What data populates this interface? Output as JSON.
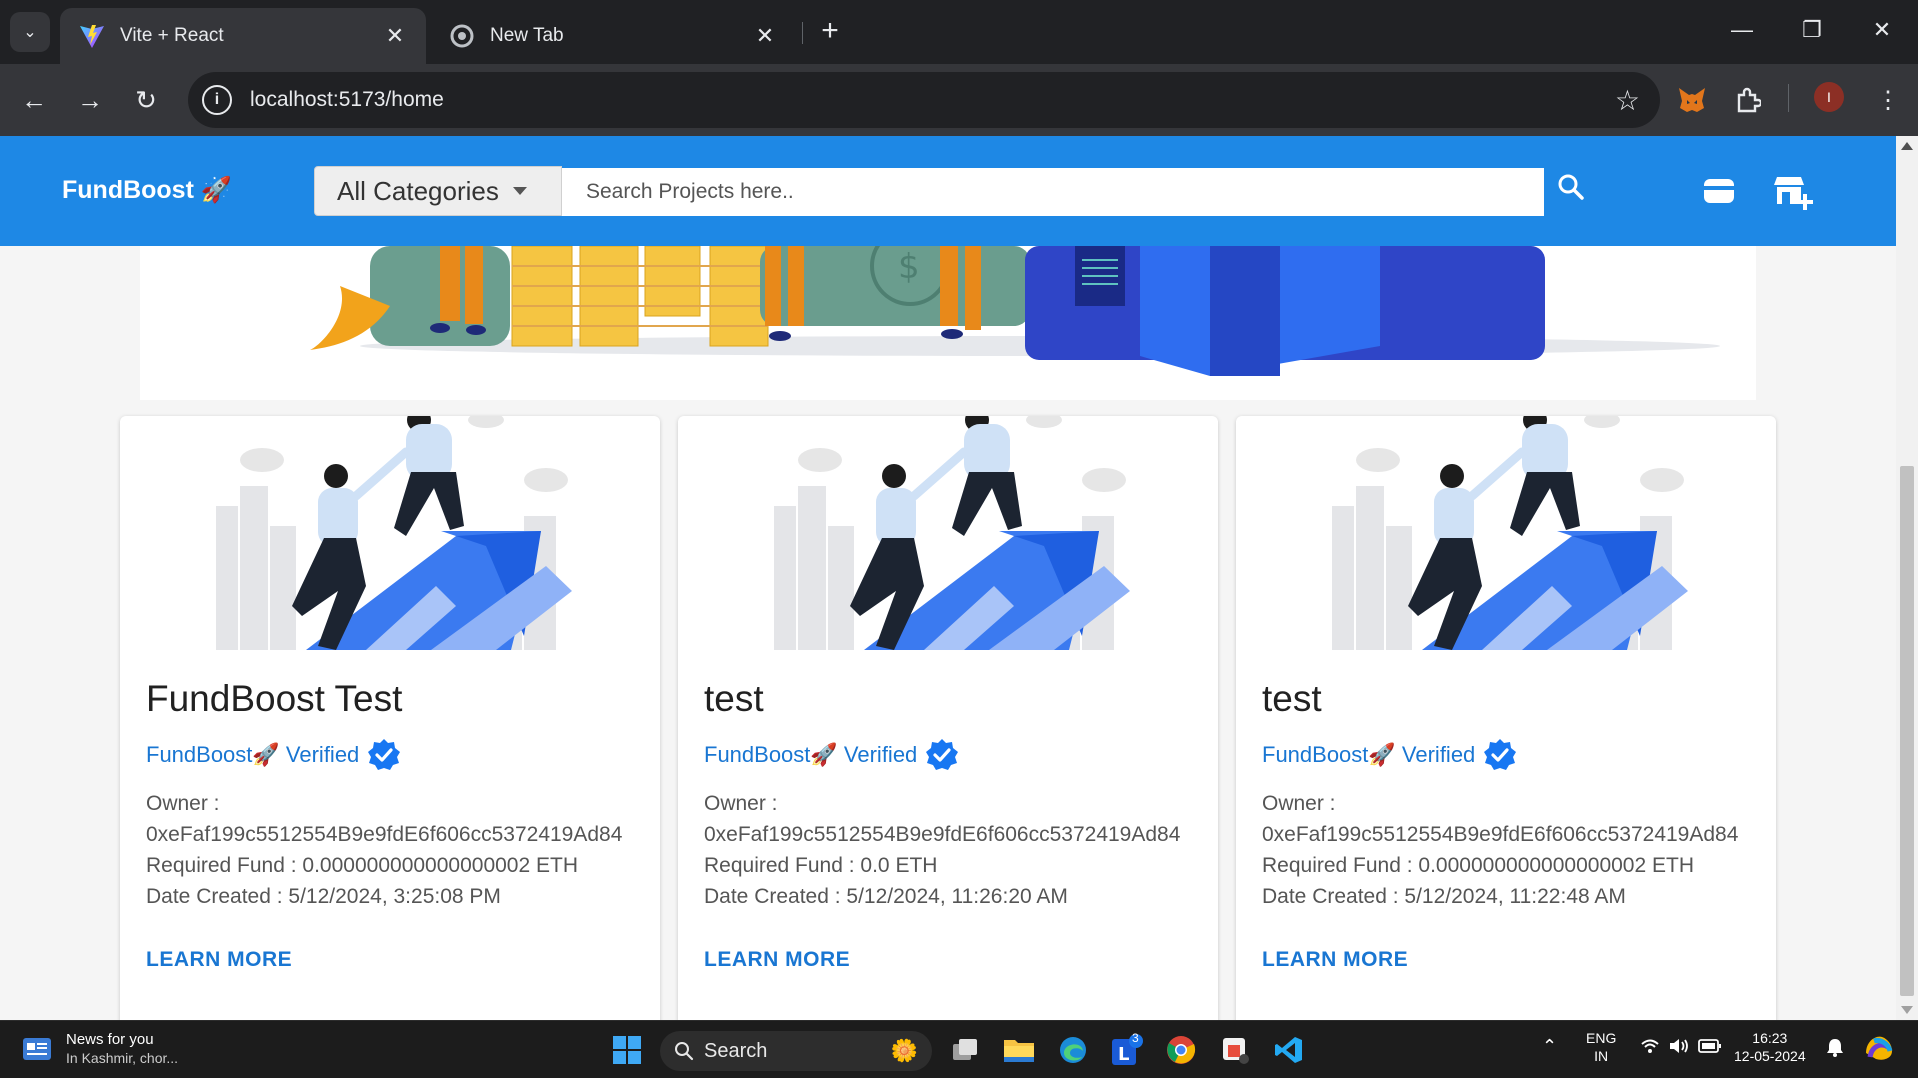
{
  "browser": {
    "tabs": [
      {
        "title": "Vite + React",
        "active": true
      },
      {
        "title": "New Tab",
        "active": false
      }
    ],
    "url": "localhost:5173/home",
    "profile_initial": "I"
  },
  "app": {
    "brand": "FundBoost",
    "brand_emoji": "🚀",
    "category_select": "All Categories",
    "search_placeholder": "Search Projects here..",
    "accent_color": "#1e88e5"
  },
  "projects": [
    {
      "title": "FundBoost Test",
      "verified_label": "FundBoost🚀 Verified",
      "owner_label": "Owner :",
      "owner": "0xeFaf199c5512554B9e9fdE6f606cc5372419Ad84",
      "fund": "Required Fund : 0.000000000000000002 ETH",
      "date": "Date Created : 5/12/2024, 3:25:08 PM",
      "action": "LEARN MORE"
    },
    {
      "title": "test",
      "verified_label": "FundBoost🚀 Verified",
      "owner_label": "Owner :",
      "owner": "0xeFaf199c5512554B9e9fdE6f606cc5372419Ad84",
      "fund": "Required Fund : 0.0 ETH",
      "date": "Date Created : 5/12/2024, 11:26:20 AM",
      "action": "LEARN MORE"
    },
    {
      "title": "test",
      "verified_label": "FundBoost🚀 Verified",
      "owner_label": "Owner :",
      "owner": "0xeFaf199c5512554B9e9fdE6f606cc5372419Ad84",
      "fund": "Required Fund : 0.000000000000000002 ETH",
      "date": "Date Created : 5/12/2024, 11:22:48 AM",
      "action": "LEARN MORE"
    }
  ],
  "taskbar": {
    "news_title": "News for you",
    "news_sub": "In Kashmir, chor...",
    "search_label": "Search",
    "lang_top": "ENG",
    "lang_bottom": "IN",
    "time": "16:23",
    "date": "12-05-2024",
    "badge_count": "3"
  }
}
